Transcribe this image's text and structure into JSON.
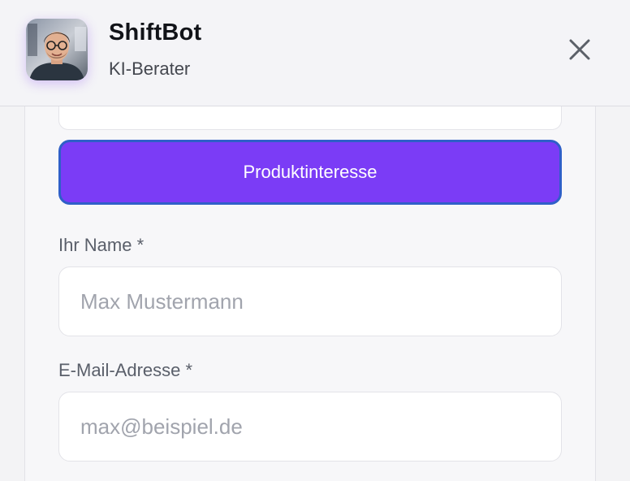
{
  "header": {
    "bot_name": "ShiftBot",
    "bot_role": "KI-Berater",
    "avatar_icon": "person-avatar-icon",
    "close_icon": "close-icon"
  },
  "form": {
    "interest_button_label": "Produktinteresse",
    "name_label": "Ihr Name *",
    "name_placeholder": "Max Mustermann",
    "email_label": "E-Mail-Adresse *",
    "email_placeholder": "max@beispiel.de"
  },
  "colors": {
    "accent": "#7b3cf6",
    "accent_border": "#2f5fc8",
    "background": "#f3f3f5",
    "text_primary": "#111318",
    "text_muted": "#5a5f6a",
    "placeholder": "#a1a4ad"
  }
}
